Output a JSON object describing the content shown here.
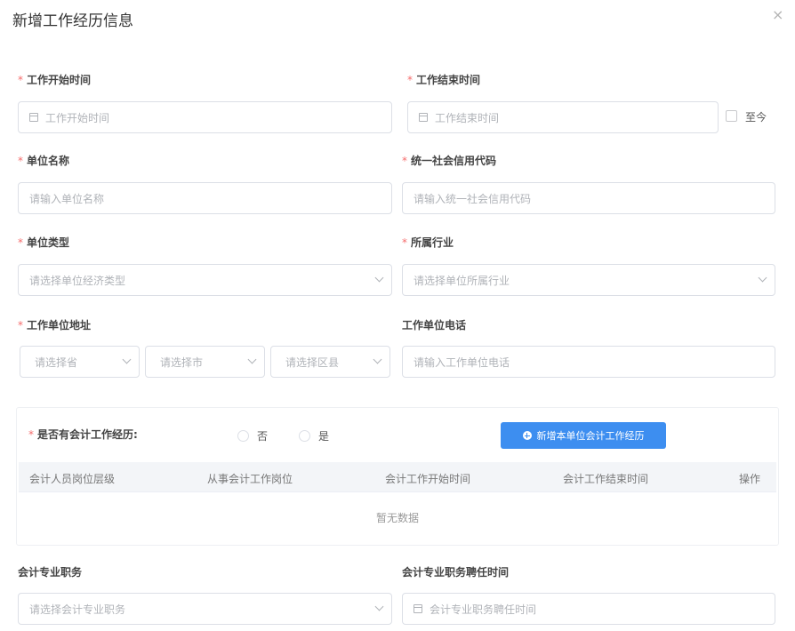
{
  "dialog": {
    "title": "新增工作经历信息",
    "close": "×"
  },
  "form": {
    "start_time": {
      "label": "工作开始时间",
      "placeholder": "工作开始时间",
      "required": "*"
    },
    "end_time": {
      "label": "工作结束时间",
      "placeholder": "工作结束时间",
      "required": "*",
      "until_now": "至今"
    },
    "unit_name": {
      "label": "单位名称",
      "placeholder": "请输入单位名称",
      "required": "*"
    },
    "credit_code": {
      "label": "统一社会信用代码",
      "placeholder": "请输入统一社会信用代码",
      "required": "*"
    },
    "unit_type": {
      "label": "单位类型",
      "placeholder": "请选择单位经济类型",
      "required": "*"
    },
    "industry": {
      "label": "所属行业",
      "placeholder": "请选择单位所属行业",
      "required": "*"
    },
    "address": {
      "label": "工作单位地址",
      "required": "*",
      "province": "请选择省",
      "city": "请选择市",
      "district": "请选择区县"
    },
    "phone": {
      "label": "工作单位电话",
      "placeholder": "请输入工作单位电话"
    },
    "accounting": {
      "label": "是否有会计工作经历:",
      "required": "*",
      "option_no": "否",
      "option_yes": "是",
      "add_button": "新增本单位会计工作经历",
      "table": {
        "columns": [
          "会计人员岗位层级",
          "从事会计工作岗位",
          "会计工作开始时间",
          "会计工作结束时间",
          "操作"
        ],
        "empty": "暂无数据"
      }
    },
    "prof_title": {
      "label": "会计专业职务",
      "placeholder": "请选择会计专业职务"
    },
    "prof_time": {
      "label": "会计专业职务聘任时间",
      "placeholder": "会计专业职务聘任时间"
    }
  }
}
